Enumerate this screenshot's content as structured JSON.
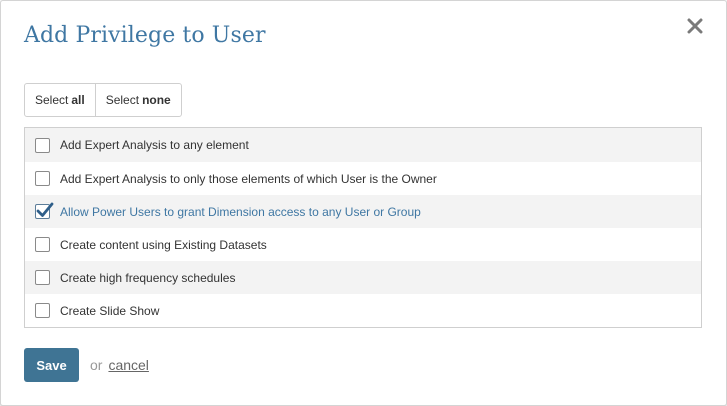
{
  "dialog": {
    "title": "Add Privilege to User",
    "close_icon": "close-icon"
  },
  "select": {
    "all_prefix": "Select",
    "all_bold": "all",
    "none_prefix": "Select",
    "none_bold": "none"
  },
  "privileges": [
    {
      "label": "Add Expert Analysis to any element",
      "checked": false
    },
    {
      "label": "Add Expert Analysis to only those elements of which User is the Owner",
      "checked": false
    },
    {
      "label": "Allow Power Users to grant Dimension access to any User or Group",
      "checked": true
    },
    {
      "label": "Create content using Existing Datasets",
      "checked": false
    },
    {
      "label": "Create high frequency schedules",
      "checked": false
    },
    {
      "label": "Create Slide Show",
      "checked": false
    }
  ],
  "footer": {
    "save_label": "Save",
    "or_label": "or",
    "cancel_label": "cancel"
  },
  "colors": {
    "accent": "#3f77a3",
    "save_button": "#3f7494"
  }
}
